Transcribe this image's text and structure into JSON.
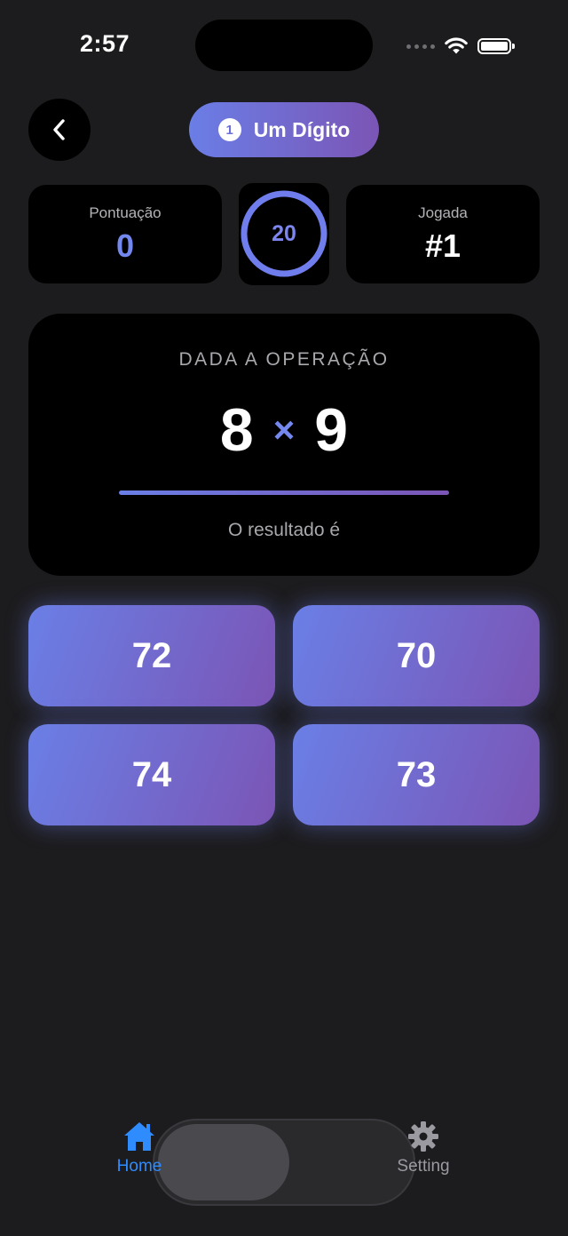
{
  "status_bar": {
    "time": "2:57"
  },
  "header": {
    "level_number": "1",
    "level_label": "Um Dígito"
  },
  "stats": {
    "score_label": "Pontuação",
    "score_value": "0",
    "timer_value": "20",
    "timer_fraction": 1.0,
    "round_label": "Jogada",
    "round_value": "#1"
  },
  "operation": {
    "heading": "DADA A OPERAÇÃO",
    "left_operand": "8",
    "operator": "×",
    "right_operand": "9",
    "subtitle": "O resultado é"
  },
  "answers": [
    "72",
    "70",
    "74",
    "73"
  ],
  "tabbar": {
    "items": [
      {
        "label": "Home",
        "icon": "home-icon",
        "active": true
      },
      {
        "label": "Setting",
        "icon": "gear-icon",
        "active": false
      }
    ]
  },
  "colors": {
    "background": "#1c1c1e",
    "card": "#000000",
    "accent_start": "#6a7ee6",
    "accent_end": "#7b55b5",
    "score_color": "#7388ee",
    "tab_active": "#2f8cff",
    "tab_inactive": "#9a9aa0"
  }
}
